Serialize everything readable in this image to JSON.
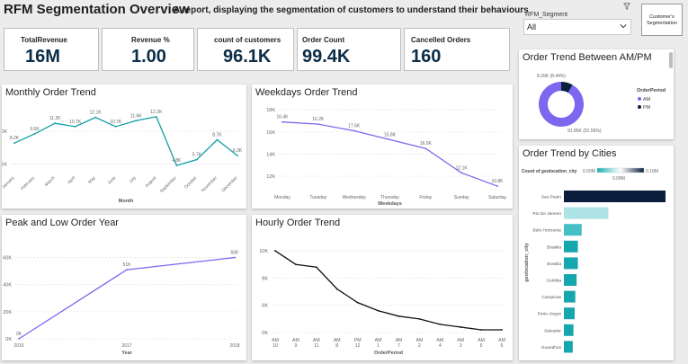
{
  "header": {
    "title": "RFM Segmentation Overview",
    "subtitle": "A report, displaying the segmentation of customers to understand their behaviours"
  },
  "slicer": {
    "label": "RFM_Segment",
    "value": "All"
  },
  "segmentation_button": {
    "label": "Customer's Segmentation"
  },
  "kpis": [
    {
      "label": "TotalRevenue",
      "value": "16M"
    },
    {
      "label": "Revenue %",
      "value": "1.00"
    },
    {
      "label": "count of customers",
      "value": "96.1K"
    },
    {
      "label": "Order Count",
      "value": "99.4K"
    },
    {
      "label": "Cancelled Orders",
      "value": "160"
    }
  ],
  "colors": {
    "teal": "#119ea6",
    "purple": "#7b68ee",
    "navy": "#0c1e3e",
    "kpi_value": "#0c2d48",
    "bar_light": "#aee3e6"
  },
  "chart_data": [
    {
      "id": "monthly",
      "type": "line",
      "title": "Monthly Order Trend",
      "xlabel": "Month",
      "ylabel": "",
      "categories": [
        "January",
        "February",
        "March",
        "April",
        "May",
        "June",
        "July",
        "August",
        "September",
        "October",
        "November",
        "December"
      ],
      "values": [
        8.2,
        9.6,
        11.2,
        10.7,
        12.1,
        10.7,
        11.6,
        12.2,
        4.8,
        5.7,
        8.7,
        6.3
      ],
      "labels": [
        "8.2K",
        "9.6K",
        "11.2K",
        "10.7K",
        "12.1K",
        "10.7K",
        "11.6K",
        "12.2K",
        "4.8K",
        "5.7K",
        "8.7K",
        "6.3K"
      ],
      "yticks": [
        "5K",
        "10K"
      ],
      "ytick_values": [
        5,
        10
      ],
      "ylim": [
        4,
        13
      ]
    },
    {
      "id": "weekdays",
      "type": "line",
      "title": "Weekdays Order Trend",
      "xlabel": "Weekdays",
      "ylabel": "",
      "categories": [
        "Monday",
        "Tuesday",
        "Wednesday",
        "Thursday",
        "Friday",
        "Sunday",
        "Saturday"
      ],
      "values": [
        16.4,
        16.2,
        15.6,
        14.8,
        14.0,
        11.8,
        10.6
      ],
      "labels": [
        "16.4K",
        "16.2K",
        "17.6K",
        "15.8K",
        "16.0K",
        "12.1K",
        "10.8K"
      ],
      "yticks": [
        "12K",
        "14K",
        "16K",
        "18K"
      ],
      "ytick_values": [
        11.5,
        13.5,
        15.5,
        17.5
      ],
      "ylim": [
        10.2,
        18.0
      ]
    },
    {
      "id": "peak_low",
      "type": "line",
      "title": "Peak and Low Order Year",
      "xlabel": "Year",
      "ylabel": "",
      "categories": [
        "2016",
        "2017",
        "2018"
      ],
      "values": [
        0,
        51,
        60
      ],
      "labels": [
        "0K",
        "51K",
        "60K"
      ],
      "yticks": [
        "0K",
        "20K",
        "40K",
        "60K"
      ],
      "ytick_values": [
        0,
        20,
        40,
        60
      ],
      "ylim": [
        0,
        65
      ]
    },
    {
      "id": "hourly",
      "type": "line",
      "title": "Hourly Order Trend",
      "xlabel": "OrderPeriod",
      "ylabel": "",
      "categories": [
        "AM 10",
        "AM 9",
        "AM 11",
        "AM 8",
        "PM 12",
        "AM 1",
        "AM 7",
        "AM 2",
        "AM 4",
        "AM 3",
        "AM 5",
        "AM 6"
      ],
      "values": [
        6.0,
        5.5,
        5.4,
        4.6,
        4.1,
        3.8,
        3.6,
        3.5,
        3.3,
        3.2,
        3.1,
        3.1
      ],
      "yticks": [
        "0K",
        "6K",
        "8K",
        "10K"
      ],
      "ytick_values": [
        3.0,
        4.0,
        5.0,
        6.0
      ],
      "ylim": [
        3.0,
        6.2
      ]
    },
    {
      "id": "ampm",
      "type": "pie",
      "title": "Order Trend Between AM/PM",
      "legend_title": "OrderPeriod",
      "slices": [
        {
          "name": "AM",
          "value": 91.5,
          "label": "91.85K (91.56%)",
          "color": "#7b68ee"
        },
        {
          "name": "PM",
          "value": 8.44,
          "label": "8.39K (8.44%)",
          "color": "#0c1e3e"
        }
      ]
    },
    {
      "id": "cities",
      "type": "bar",
      "title": "Order Trend by Cities",
      "legend_title": "Count of geolocation_city",
      "legend_min": "0.00M",
      "legend_mid": "0.08M",
      "legend_max": "0.16M",
      "ylabel": "geolocation_city",
      "categories": [
        "Sao Paulo",
        "Rio De Janeiro",
        "Belo Horizonte",
        "Brasilia",
        "Brasilia",
        "Curitiba",
        "Campinas",
        "Porto Alegre",
        "Salvador",
        "Guarulhos"
      ],
      "values": [
        0.16,
        0.07,
        0.028,
        0.022,
        0.022,
        0.02,
        0.018,
        0.017,
        0.015,
        0.014
      ]
    }
  ]
}
